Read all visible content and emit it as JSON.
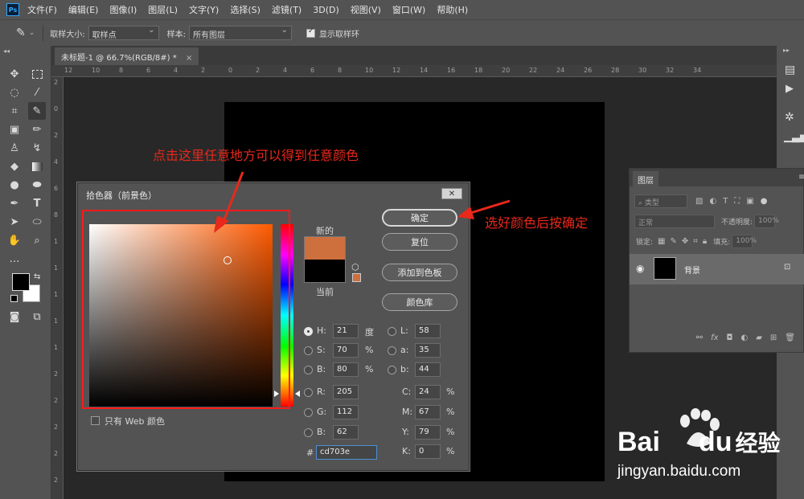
{
  "menu": [
    "文件(F)",
    "编辑(E)",
    "图像(I)",
    "图层(L)",
    "文字(Y)",
    "选择(S)",
    "滤镜(T)",
    "3D(D)",
    "视图(V)",
    "窗口(W)",
    "帮助(H)"
  ],
  "app_logo": "Ps",
  "options": {
    "sample_size_label": "取样大小:",
    "sample_size_value": "取样点",
    "sample_label": "样本:",
    "sample_value": "所有图层",
    "show_ring_label": "显示取样环",
    "show_ring_checked": true
  },
  "doc_tab": "未标题-1 @ 66.7%(RGB/8#) *",
  "ruler_top": [
    "12",
    "10",
    "8",
    "6",
    "4",
    "2",
    "0",
    "2",
    "4",
    "6",
    "8",
    "10",
    "12",
    "14",
    "16",
    "18",
    "20",
    "22",
    "24",
    "26",
    "28",
    "30",
    "32",
    "34"
  ],
  "ruler_left": [
    "2",
    "0",
    "2",
    "4",
    "6",
    "8",
    "1",
    "1",
    "1",
    "1",
    "1",
    "2",
    "2",
    "2",
    "2",
    "2"
  ],
  "layers": {
    "tab": "图层",
    "kind_placeholder": "类型",
    "blend_mode": "正常",
    "opacity_label": "不透明度:",
    "opacity_value": "100%",
    "lock_label": "锁定:",
    "fill_label": "填充:",
    "fill_value": "100%",
    "layer_name": "背景"
  },
  "dialog": {
    "title": "拾色器（前景色）",
    "new_label": "新的",
    "current_label": "当前",
    "ok": "确定",
    "reset": "复位",
    "add_swatch": "添加到色板",
    "libraries": "颜色库",
    "web_only": "只有 Web 颜色",
    "hsb": [
      {
        "label": "H:",
        "value": "21",
        "unit": "度",
        "selected": true
      },
      {
        "label": "S:",
        "value": "70",
        "unit": "%",
        "selected": false
      },
      {
        "label": "B:",
        "value": "80",
        "unit": "%",
        "selected": false
      }
    ],
    "rgb": [
      {
        "label": "R:",
        "value": "205",
        "selected": false
      },
      {
        "label": "G:",
        "value": "112",
        "selected": false
      },
      {
        "label": "B:",
        "value": "62",
        "selected": false
      }
    ],
    "lab": [
      {
        "label": "L:",
        "value": "58"
      },
      {
        "label": "a:",
        "value": "35"
      },
      {
        "label": "b:",
        "value": "44"
      }
    ],
    "cmyk": [
      {
        "label": "C:",
        "value": "24",
        "unit": "%"
      },
      {
        "label": "M:",
        "value": "67",
        "unit": "%"
      },
      {
        "label": "Y:",
        "value": "79",
        "unit": "%"
      },
      {
        "label": "K:",
        "value": "0",
        "unit": "%"
      }
    ],
    "hex_label": "#",
    "hex_value": "cd703e"
  },
  "colors": {
    "new_color": "#cd703e",
    "current_color": "#000000",
    "annotation": "#e8281b"
  },
  "annotations": {
    "top": "点击这里任意地方可以得到任意颜色",
    "right": "选好颜色后按确定"
  },
  "watermark": {
    "brand_a": "Bai",
    "brand_b": "du",
    "brand_cn": "经验",
    "url": "jingyan.baidu.com"
  }
}
